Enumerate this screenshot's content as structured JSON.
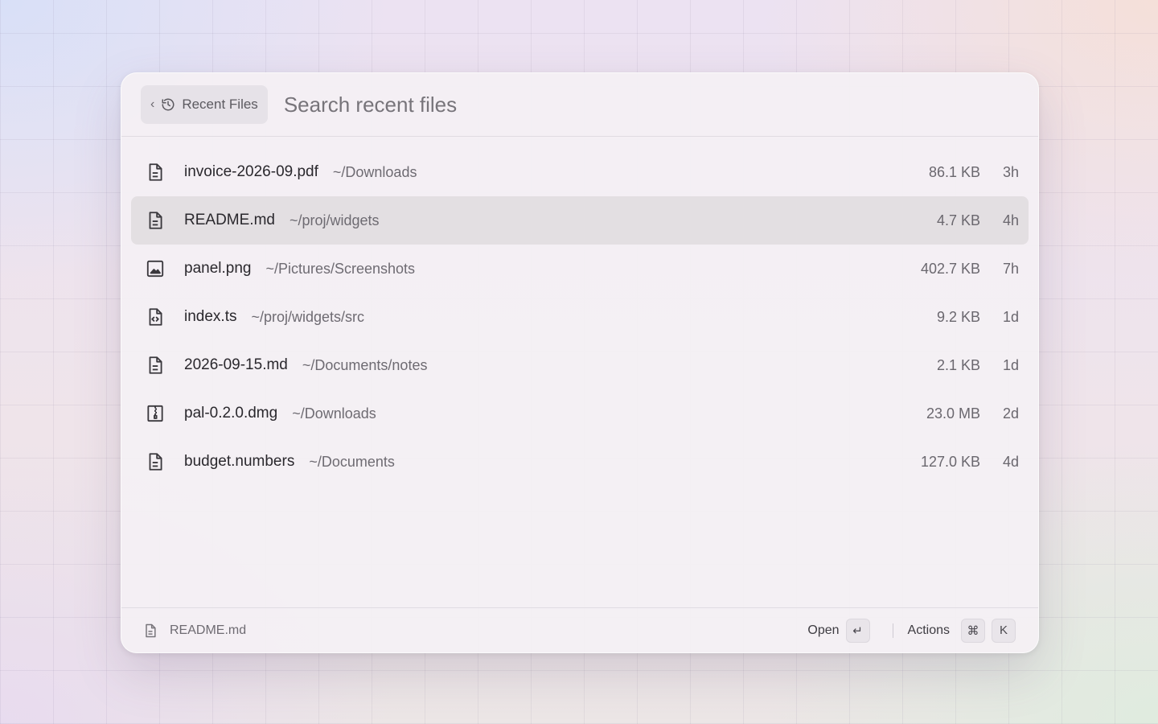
{
  "header": {
    "back_label": "‹",
    "crumb_label": "Recent Files",
    "search_placeholder": "Search recent files"
  },
  "files": [
    {
      "name": "invoice-2026-09.pdf",
      "path": "~/Downloads",
      "size": "86.1 KB",
      "age": "3h",
      "icon": "document-icon",
      "selected": false
    },
    {
      "name": "README.md",
      "path": "~/proj/widgets",
      "size": "4.7 KB",
      "age": "4h",
      "icon": "document-icon",
      "selected": true
    },
    {
      "name": "panel.png",
      "path": "~/Pictures/Screenshots",
      "size": "402.7 KB",
      "age": "7h",
      "icon": "image-icon",
      "selected": false
    },
    {
      "name": "index.ts",
      "path": "~/proj/widgets/src",
      "size": "9.2 KB",
      "age": "1d",
      "icon": "code-file-icon",
      "selected": false
    },
    {
      "name": "2026-09-15.md",
      "path": "~/Documents/notes",
      "size": "2.1 KB",
      "age": "1d",
      "icon": "document-icon",
      "selected": false
    },
    {
      "name": "pal-0.2.0.dmg",
      "path": "~/Downloads",
      "size": "23.0 MB",
      "age": "2d",
      "icon": "archive-icon",
      "selected": false
    },
    {
      "name": "budget.numbers",
      "path": "~/Documents",
      "size": "127.0 KB",
      "age": "4d",
      "icon": "document-icon",
      "selected": false
    }
  ],
  "footer": {
    "selected_name": "README.md",
    "open_label": "Open",
    "open_key": "↵",
    "actions_label": "Actions",
    "actions_key_1": "⌘",
    "actions_key_2": "K"
  }
}
